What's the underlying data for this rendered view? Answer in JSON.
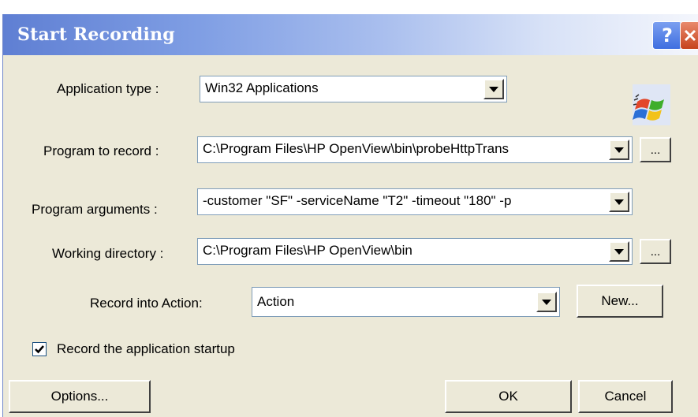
{
  "dialog": {
    "title": "Start Recording",
    "help_label": "?",
    "close_label": "✕"
  },
  "fields": {
    "application_type": {
      "label": "Application type :",
      "value": "Win32 Applications"
    },
    "program_to_record": {
      "label": "Program to record :",
      "value": "C:\\Program Files\\HP OpenView\\bin\\probeHttpTrans",
      "browse_label": "..."
    },
    "program_arguments": {
      "label": "Program arguments :",
      "value": "-customer \"SF\" -serviceName \"T2\" -timeout \"180\" -p"
    },
    "working_directory": {
      "label": "Working directory :",
      "value": "C:\\Program Files\\HP OpenView\\bin",
      "browse_label": "..."
    },
    "record_into_action": {
      "label": "Record into Action:",
      "value": "Action",
      "new_label": "New..."
    }
  },
  "record_startup": {
    "label": "Record the application startup",
    "checked": true
  },
  "buttons": {
    "options": "Options...",
    "ok": "OK",
    "cancel": "Cancel"
  },
  "icons": {
    "windows_logo": "windows-flag-icon"
  },
  "colors": {
    "dialog_bg": "#ece9d8",
    "title_start": "#5f7fd3",
    "close_red": "#c6431d"
  }
}
